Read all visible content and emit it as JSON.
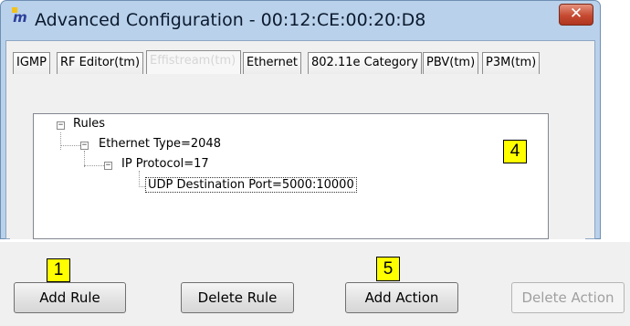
{
  "window": {
    "title": "Advanced Configuration - 00:12:CE:00:20:D8",
    "app_icon_glyph": "m",
    "close_glyph": "✕"
  },
  "tabs": [
    {
      "label": "IGMP"
    },
    {
      "label": "RF Editor(tm)"
    },
    {
      "label": "Effistream(tm)",
      "active": true
    },
    {
      "label": "Ethernet"
    },
    {
      "label": "802.11e Category"
    },
    {
      "label": "PBV(tm)"
    },
    {
      "label": "P3M(tm)"
    }
  ],
  "tree": {
    "root": {
      "label": "Rules",
      "toggle": "−"
    },
    "child": {
      "label": "Ethernet Type=2048",
      "toggle": "−"
    },
    "grandchild": {
      "label": "IP Protocol=17",
      "toggle": "−"
    },
    "leaf": {
      "label": "UDP Destination Port=5000:10000"
    }
  },
  "callouts": {
    "tree": "4",
    "add_rule": "1",
    "add_action": "5"
  },
  "buttons": {
    "add_rule": "Add Rule",
    "delete_rule": "Delete Rule",
    "add_action": "Add Action",
    "delete_action": "Delete Action"
  },
  "colors": {
    "callout": "#ffff00",
    "close_button": "#c54a31",
    "title_bar": "#b9d1ea"
  }
}
